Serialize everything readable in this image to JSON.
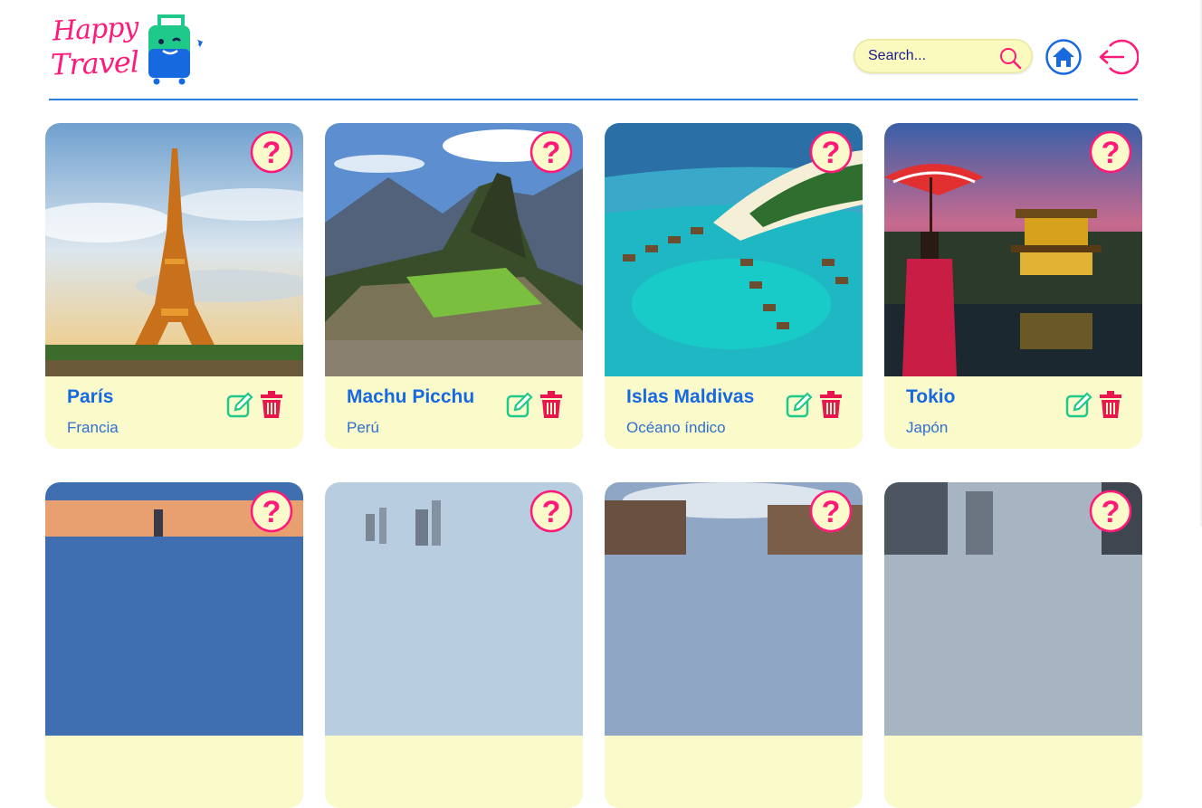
{
  "app": {
    "logo_line1": "Happy",
    "logo_line2": "Travel"
  },
  "search": {
    "placeholder": "Search..."
  },
  "colors": {
    "accent": "#ff1a7a",
    "primary": "#1769e0",
    "card_bg": "#fafacb",
    "search_bg": "#fafabf",
    "edit_green": "#1fc98a"
  },
  "icons": [
    "search-icon",
    "home-icon",
    "logout-icon",
    "question-icon",
    "edit-icon",
    "trash-icon",
    "suitcase-mascot-icon"
  ],
  "destinations": [
    {
      "title": "París",
      "subtitle": "Francia"
    },
    {
      "title": "Machu Picchu",
      "subtitle": "Perú"
    },
    {
      "title": "Islas Maldivas",
      "subtitle": "Océano índico"
    },
    {
      "title": "Tokio",
      "subtitle": "Japón"
    }
  ]
}
